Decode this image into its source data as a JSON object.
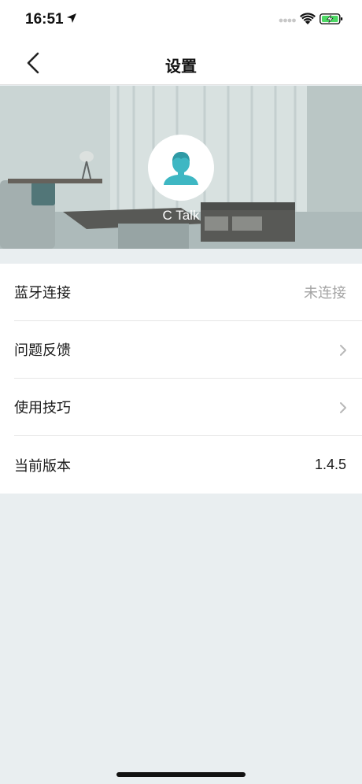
{
  "status_bar": {
    "time": "16:51",
    "icons": [
      "location-arrow-icon",
      "signal-icon",
      "wifi-icon",
      "battery-charging-icon"
    ]
  },
  "nav": {
    "title": "设置",
    "back_icon": "chevron-left-icon"
  },
  "profile": {
    "name": "C Talk",
    "avatar_icon": "user-avatar-icon",
    "avatar_color": "#3eb7c3"
  },
  "settings": {
    "items": [
      {
        "label": "蓝牙连接",
        "value": "未连接",
        "trailing": "text"
      },
      {
        "label": "问题反馈",
        "value": "",
        "trailing": "chevron-right-icon"
      },
      {
        "label": "使用技巧",
        "value": "",
        "trailing": "chevron-right-icon"
      },
      {
        "label": "当前版本",
        "value": "1.4.5",
        "trailing": "text"
      }
    ]
  },
  "colors": {
    "page_background": "#e9eef0",
    "accent": "#3eb7c3",
    "battery": "#4cd964",
    "muted_text": "#a4a4a4"
  }
}
